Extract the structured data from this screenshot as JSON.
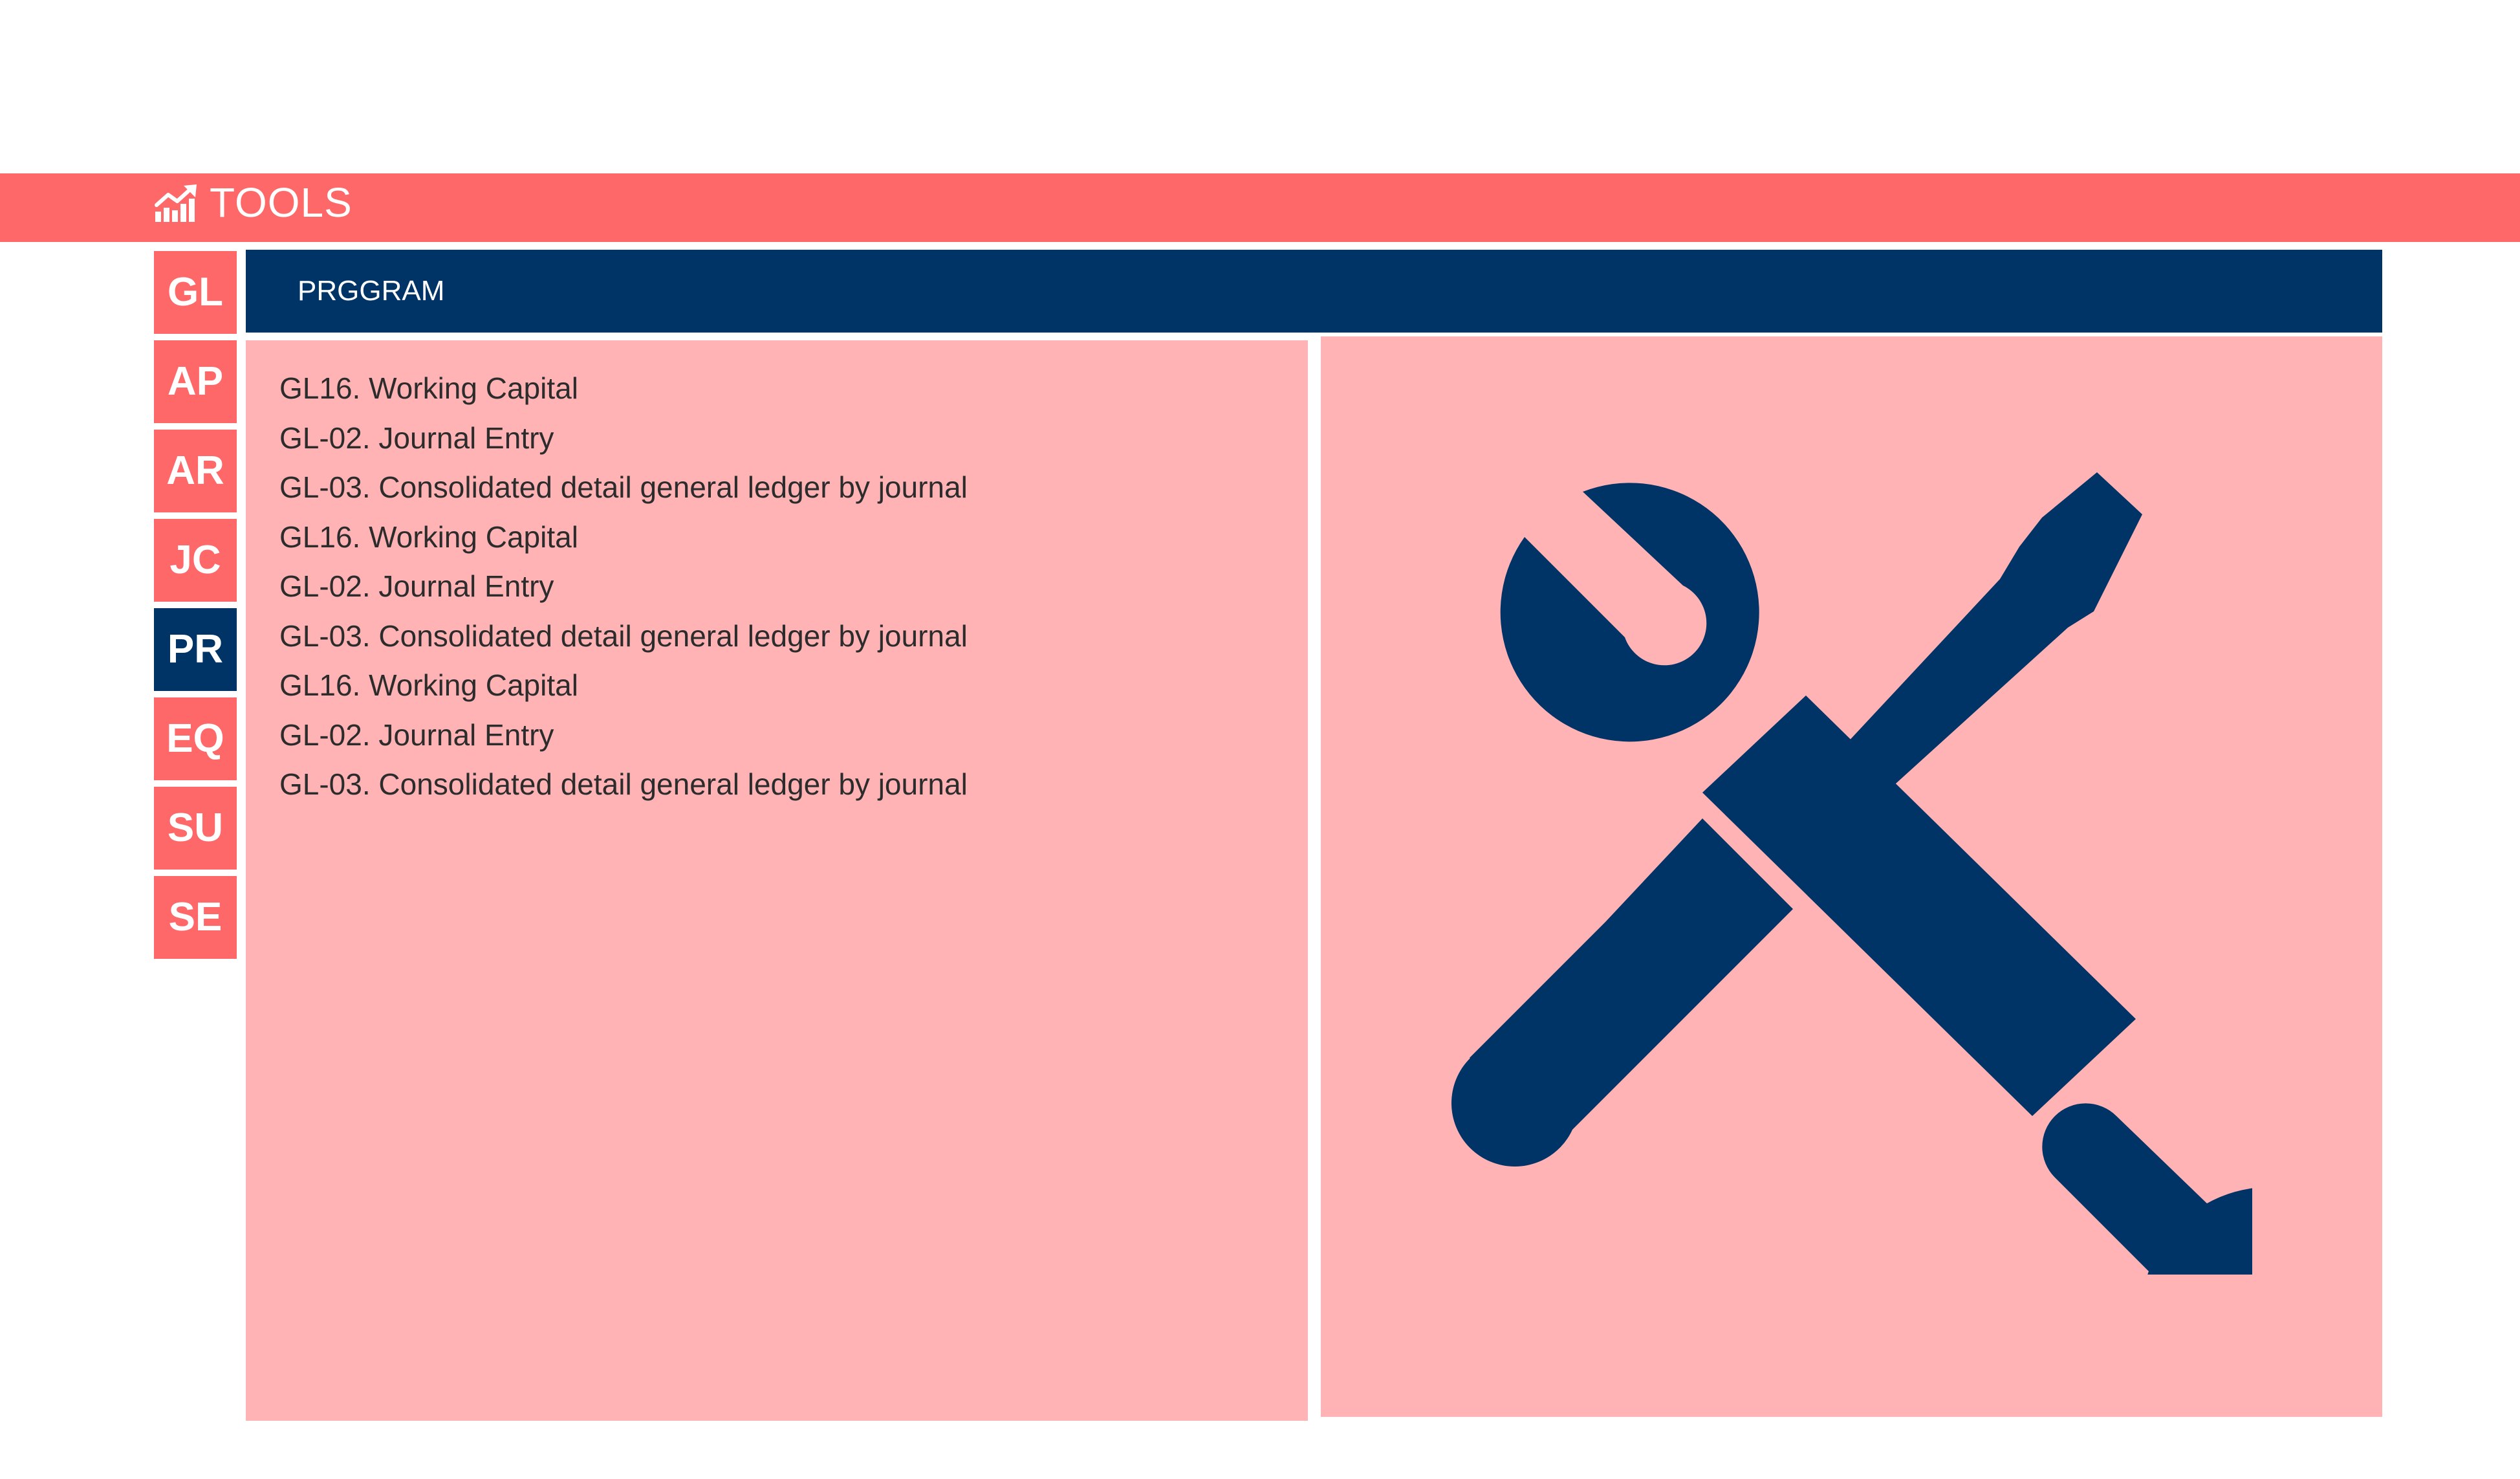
{
  "header": {
    "title": "TOOLS",
    "icon": "chart-growth-icon"
  },
  "modules": [
    {
      "code": "GL",
      "active": false
    },
    {
      "code": "AP",
      "active": false
    },
    {
      "code": "AR",
      "active": false
    },
    {
      "code": "JC",
      "active": false
    },
    {
      "code": "PR",
      "active": true
    },
    {
      "code": "EQ",
      "active": false
    },
    {
      "code": "SU",
      "active": false
    },
    {
      "code": "SE",
      "active": false
    }
  ],
  "program": {
    "header_label": "PRGGRAM",
    "items": [
      "GL16. Working Capital",
      "GL-02. Journal Entry",
      "GL-03. Consolidated detail general ledger by journal",
      "GL16. Working Capital",
      "GL-02. Journal Entry",
      "GL-03. Consolidated detail general ledger by journal",
      "GL16. Working Capital",
      "GL-02. Journal Entry",
      "GL-03. Consolidated detail general ledger by journal"
    ]
  },
  "illustration": {
    "icon": "wrench-screwdriver-icon"
  },
  "colors": {
    "accent": "#ff6868",
    "navy": "#003366",
    "panel": "#ffb3b5",
    "text": "#2c2c2c"
  }
}
